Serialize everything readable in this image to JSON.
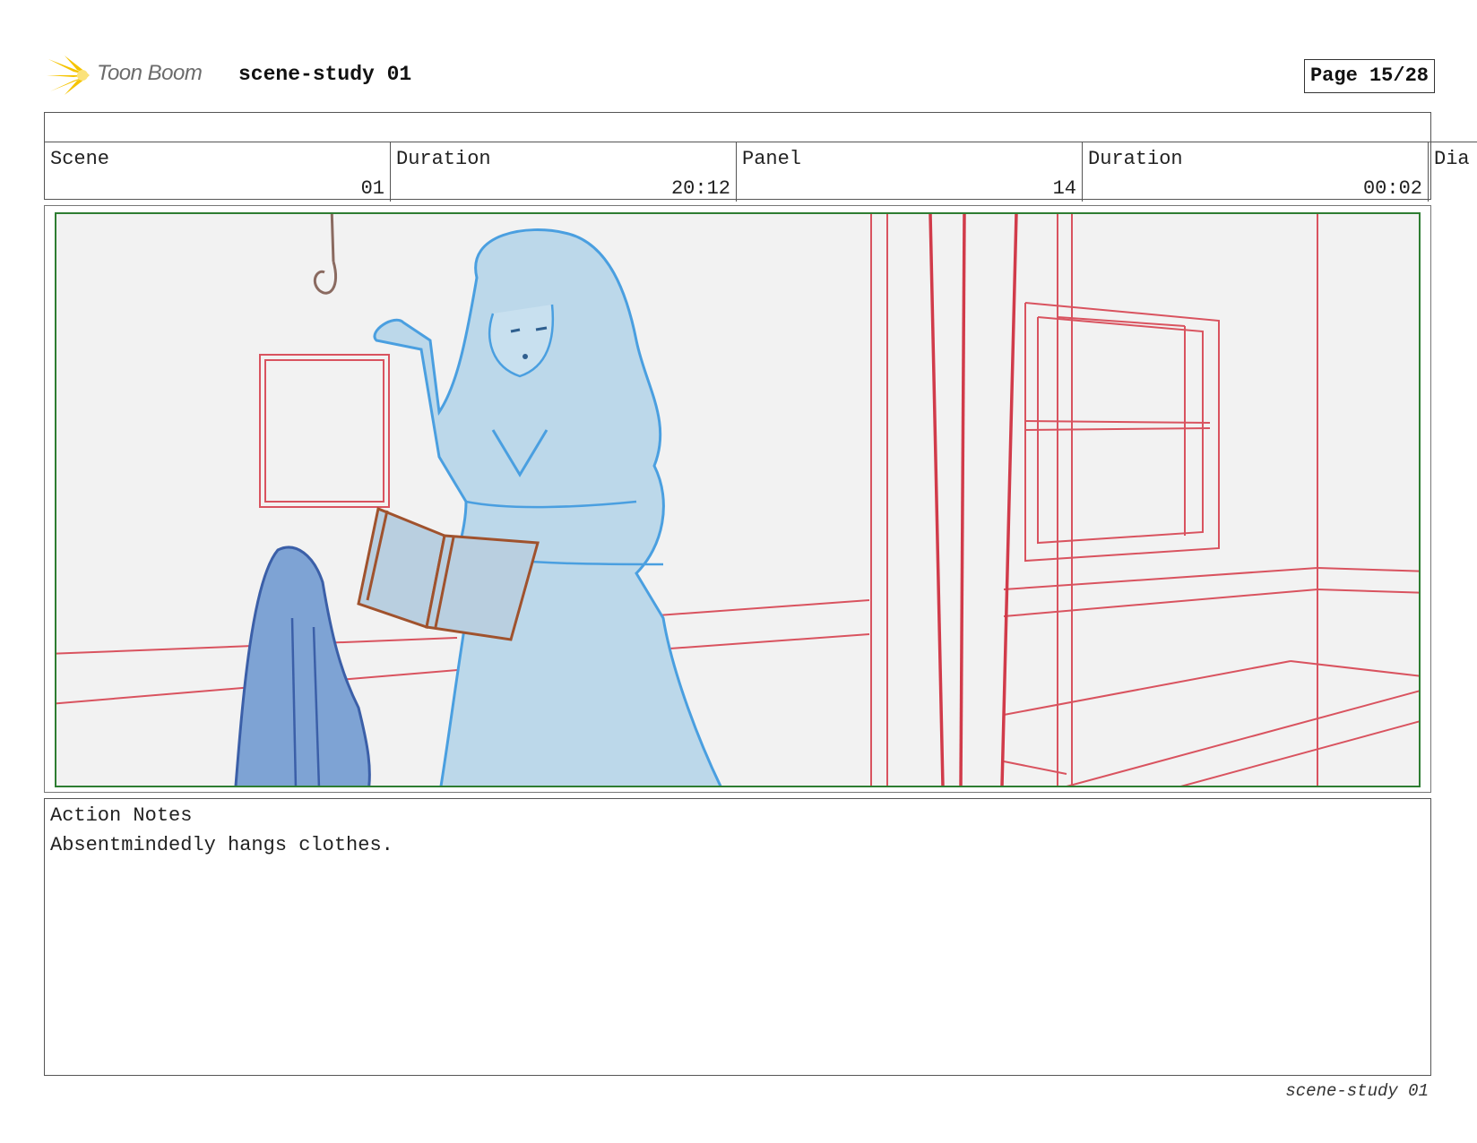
{
  "header": {
    "logo_text": "Toon Boom",
    "doc_title": "scene-study 01",
    "page_indicator": "Page 15/28"
  },
  "info": {
    "scene": {
      "label": "Scene",
      "value": "01"
    },
    "scene_duration": {
      "label": "Duration",
      "value": "20:12"
    },
    "panel": {
      "label": "Panel",
      "value": "14"
    },
    "panel_duration": {
      "label": "Duration",
      "value": "00:02"
    },
    "dialog": {
      "label": "Dia"
    }
  },
  "notes": {
    "label": "Action Notes",
    "text": "Absentmindedly hangs clothes."
  },
  "footer": {
    "text": "scene-study 01"
  },
  "colors": {
    "frame_border": "#2e7d32",
    "sketch_red": "#d9535f",
    "sketch_blue": "#4a9fe0",
    "figure_fill": "#bcd8ea",
    "coat_fill": "#7ea3d4",
    "book_brown": "#a0522d",
    "logo_yellow": "#f5c400"
  }
}
